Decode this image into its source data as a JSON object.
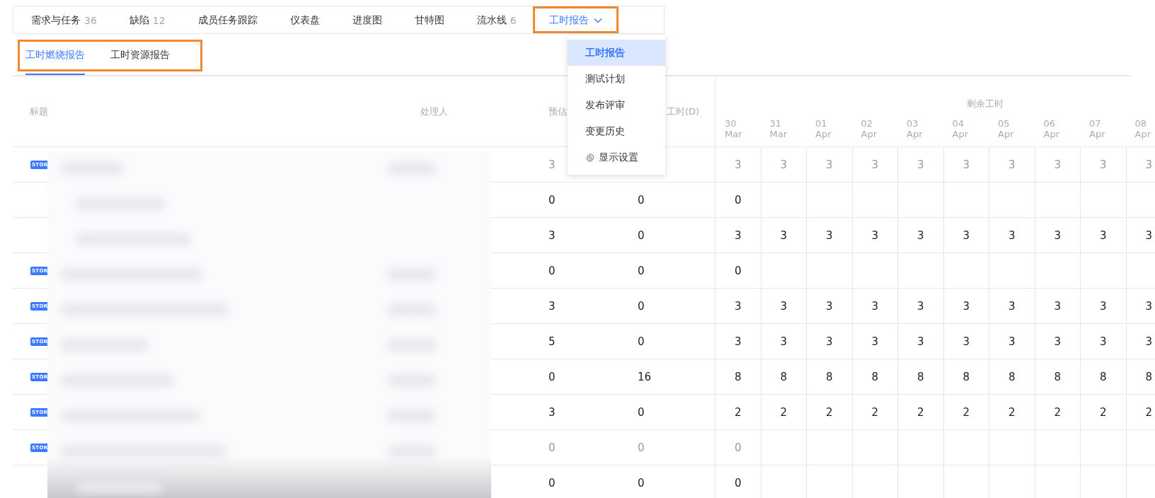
{
  "tabs": [
    {
      "label": "需求与任务",
      "count": "36",
      "selected": false,
      "dropdown": false,
      "highlighted": false
    },
    {
      "label": "缺陷",
      "count": "12",
      "selected": false,
      "dropdown": false,
      "highlighted": false
    },
    {
      "label": "成员任务跟踪",
      "selected": false,
      "dropdown": false,
      "highlighted": false
    },
    {
      "label": "仪表盘",
      "selected": false,
      "dropdown": false,
      "highlighted": false
    },
    {
      "label": "进度图",
      "selected": false,
      "dropdown": false,
      "highlighted": false
    },
    {
      "label": "甘特图",
      "selected": false,
      "dropdown": false,
      "highlighted": false
    },
    {
      "label": "流水线",
      "count": "6",
      "selected": false,
      "dropdown": false,
      "highlighted": false
    },
    {
      "label": "工时报告",
      "selected": true,
      "dropdown": true,
      "highlighted": true
    }
  ],
  "menu": {
    "items": [
      {
        "label": "工时报告",
        "selected": true,
        "kind": "plain"
      },
      {
        "label": "测试计划",
        "selected": false,
        "kind": "plain"
      },
      {
        "label": "发布评审",
        "selected": false,
        "kind": "plain"
      },
      {
        "label": "变更历史",
        "selected": false,
        "kind": "plain"
      },
      {
        "label": "显示设置",
        "selected": false,
        "kind": "settings"
      }
    ]
  },
  "subtabs": {
    "highlighted": true,
    "items": [
      {
        "label": "工时燃烧报告",
        "selected": true
      },
      {
        "label": "工时资源报告",
        "selected": false
      }
    ]
  },
  "table": {
    "columns": [
      "标题",
      "处理人",
      "预估",
      "工时(D)"
    ],
    "group_header": "剩余工时",
    "dates": [
      {
        "day": "30",
        "month": "Mar"
      },
      {
        "day": "31",
        "month": "Mar"
      },
      {
        "day": "01",
        "month": "Apr"
      },
      {
        "day": "02",
        "month": "Apr"
      },
      {
        "day": "03",
        "month": "Apr"
      },
      {
        "day": "04",
        "month": "Apr"
      },
      {
        "day": "05",
        "month": "Apr"
      },
      {
        "day": "06",
        "month": "Apr"
      },
      {
        "day": "07",
        "month": "Apr"
      },
      {
        "day": "08",
        "month": "Apr"
      }
    ],
    "rows": [
      {
        "badge": "STOR",
        "muted": true,
        "estimate": "3",
        "days": [
          "3",
          "3",
          "3",
          "3",
          "3",
          "3",
          "3",
          "3",
          "3",
          "3"
        ]
      },
      {
        "muted": false,
        "estimate": "0",
        "column_4": "0",
        "days": [
          "0"
        ]
      },
      {
        "muted": false,
        "estimate": "3",
        "column_4": "0",
        "days": [
          "3",
          "3",
          "3",
          "3",
          "3",
          "3",
          "3",
          "3",
          "3",
          "3"
        ]
      },
      {
        "badge": "STOR",
        "muted": false,
        "estimate": "0",
        "column_4": "0",
        "days": [
          "0"
        ]
      },
      {
        "badge": "STOR",
        "muted": false,
        "estimate": "3",
        "column_4": "0",
        "days": [
          "3",
          "3",
          "3",
          "3",
          "3",
          "3",
          "3",
          "3",
          "3",
          "3"
        ]
      },
      {
        "badge": "STOR",
        "muted": false,
        "estimate": "5",
        "column_4": "0",
        "days": [
          "3",
          "3",
          "3",
          "3",
          "3",
          "3",
          "3",
          "3",
          "3",
          "3"
        ]
      },
      {
        "badge": "STOR",
        "muted": false,
        "estimate": "0",
        "column_4": "16",
        "days": [
          "8",
          "8",
          "8",
          "8",
          "8",
          "8",
          "8",
          "8",
          "8",
          "8"
        ]
      },
      {
        "badge": "STOR",
        "muted": false,
        "estimate": "3",
        "column_4": "0",
        "days": [
          "2",
          "2",
          "2",
          "2",
          "2",
          "2",
          "2",
          "2",
          "2",
          "2"
        ]
      },
      {
        "badge": "STOR",
        "muted": true,
        "estimate": "0",
        "column_4": "0",
        "days": [
          "0"
        ]
      },
      {
        "muted": false,
        "estimate": "0",
        "column_4": "0",
        "days": [
          "0"
        ]
      }
    ]
  }
}
